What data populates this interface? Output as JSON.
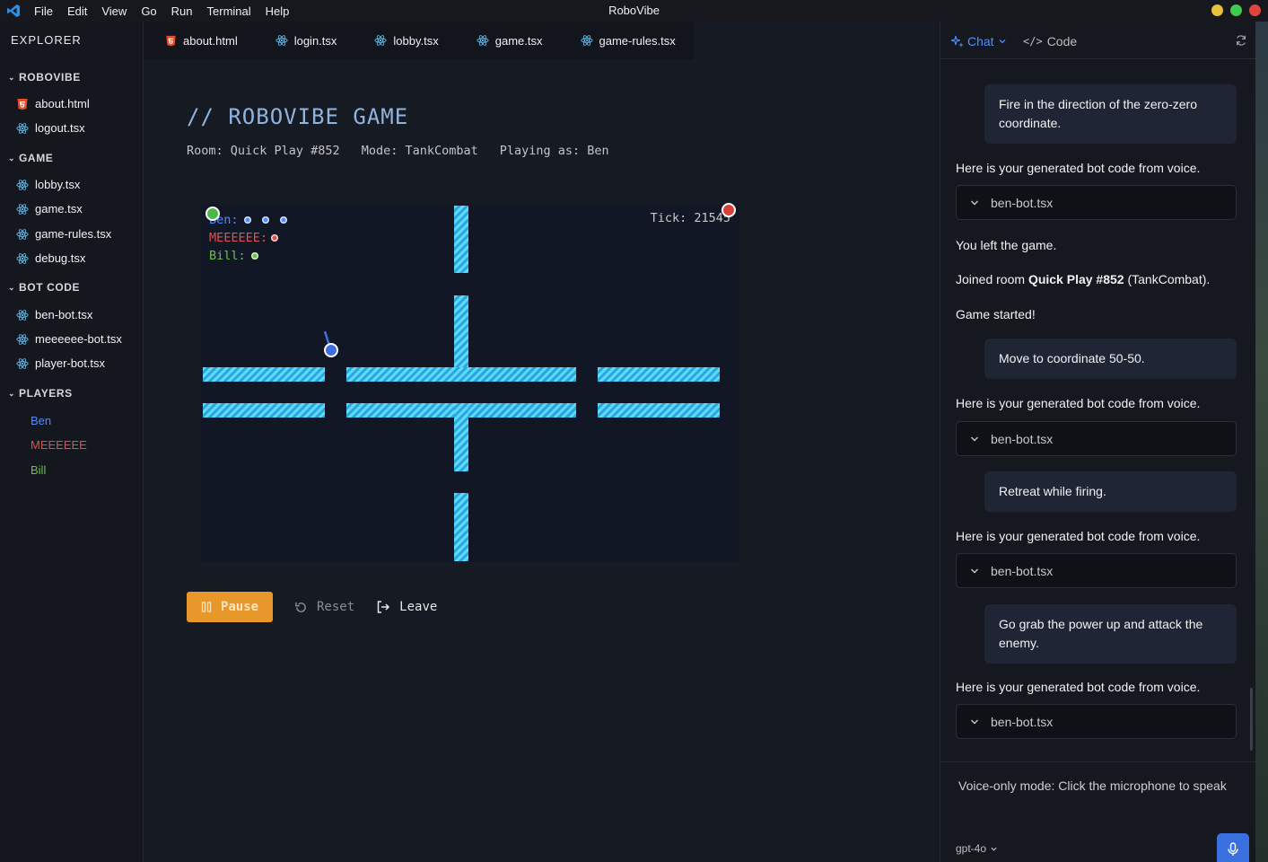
{
  "titlebar": {
    "menu": [
      "File",
      "Edit",
      "View",
      "Go",
      "Run",
      "Terminal",
      "Help"
    ],
    "app_title": "RoboVibe",
    "window_controls": [
      "#e7c13b",
      "#3fc94d",
      "#e0443e"
    ]
  },
  "sidebar": {
    "title": "EXPLORER",
    "sections": {
      "robovibe": {
        "label": "ROBOVIBE",
        "files": [
          "about.html",
          "logout.tsx"
        ]
      },
      "game": {
        "label": "GAME",
        "files": [
          "lobby.tsx",
          "game.tsx",
          "game-rules.tsx",
          "debug.tsx"
        ]
      },
      "bot_code": {
        "label": "BOT CODE",
        "files": [
          "ben-bot.tsx",
          "meeeeee-bot.tsx",
          "player-bot.tsx"
        ]
      },
      "players": {
        "label": "PLAYERS",
        "items": [
          {
            "name": "Ben",
            "color": "#4f8bff"
          },
          {
            "name": "MEEEEEE",
            "color": "#e0514a"
          },
          {
            "name": "Bill",
            "color": "#6cc04a"
          }
        ]
      }
    }
  },
  "tabs": [
    "about.html",
    "login.tsx",
    "lobby.tsx",
    "game.tsx",
    "game-rules.tsx"
  ],
  "game": {
    "title": "// ROBOVIBE GAME",
    "room": "Room: Quick Play #852",
    "mode": "Mode: TankCombat",
    "playing_as": "Playing as: Ben",
    "scores": [
      {
        "label": "Ben:",
        "color": "#4f8bff",
        "dots": 3
      },
      {
        "label": "MEEEEEE:",
        "color": "#e0514a",
        "dots": 1
      },
      {
        "label": "Bill:",
        "color": "#6cc04a",
        "dots": 1
      }
    ],
    "tick": "Tick: 21545",
    "controls": {
      "pause": "Pause",
      "reset": "Reset",
      "leave": "Leave"
    }
  },
  "chat": {
    "tab_active": "Chat",
    "tab_other": "Code",
    "messages": {
      "m1": "Fire in the direction of the zero-zero coordinate.",
      "b1": "Here is your generated bot code from voice.",
      "c1": "ben-bot.tsx",
      "s1": "You left the game.",
      "s2_prefix": "Joined room ",
      "s2_bold": "Quick Play #852",
      "s2_suffix": " (TankCombat).",
      "s3": "Game started!",
      "m2": "Move to coordinate 50-50.",
      "b2": "Here is your generated bot code from voice.",
      "c2": "ben-bot.tsx",
      "m3": "Retreat while firing.",
      "b3": "Here is your generated bot code from voice.",
      "c3": "ben-bot.tsx",
      "m4": "Go grab the power up and attack the enemy.",
      "b4": "Here is your generated bot code from voice.",
      "c4": "ben-bot.tsx"
    },
    "voice_note": "Voice-only mode: Click the microphone to speak",
    "model": "gpt-4o"
  }
}
